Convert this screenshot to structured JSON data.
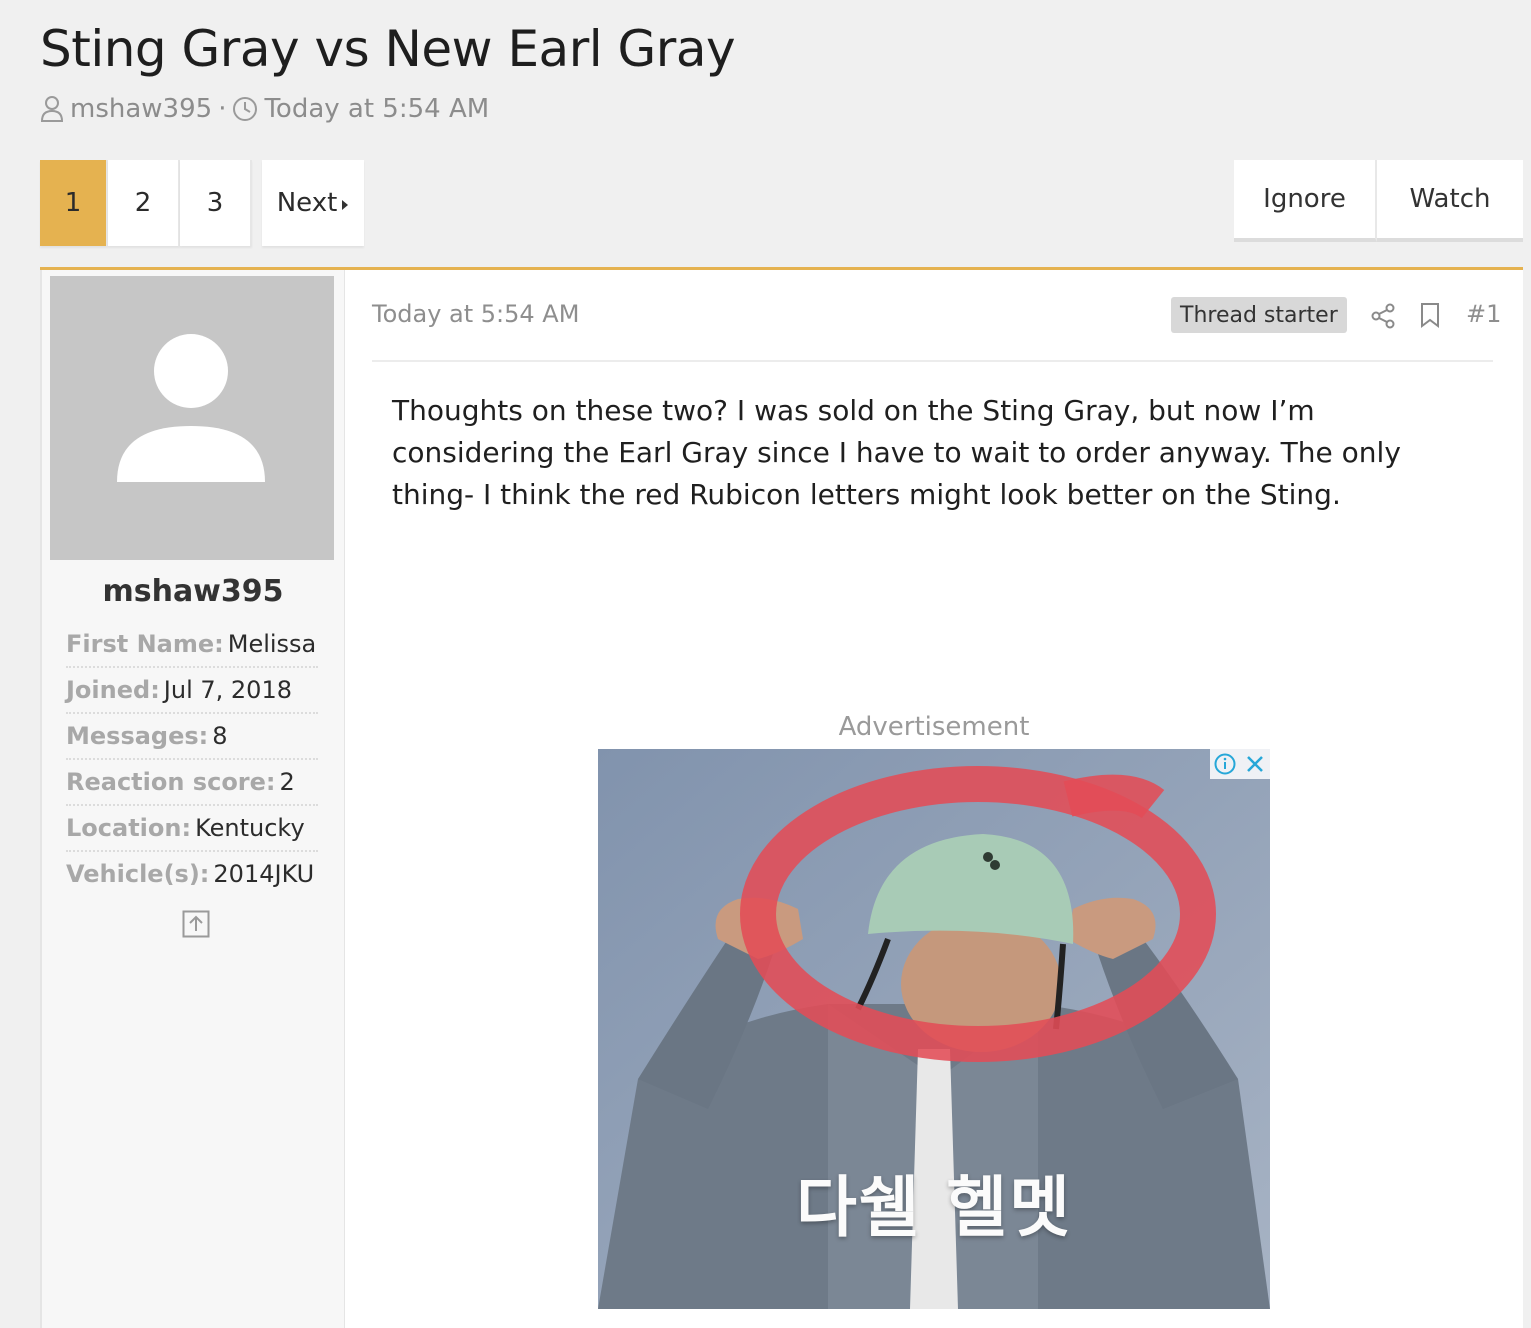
{
  "thread": {
    "title": "Sting Gray vs New Earl Gray",
    "author": "mshaw395",
    "separator": "·",
    "date": "Today at 5:54 AM"
  },
  "pagination": {
    "pages": [
      "1",
      "2",
      "3"
    ],
    "current": "1",
    "next_label": "Next"
  },
  "actions": {
    "ignore_label": "Ignore",
    "watch_label": "Watch"
  },
  "post": {
    "user": {
      "username": "mshaw395",
      "extras": [
        {
          "label": "First Name:",
          "value": "Melissa"
        },
        {
          "label": "Joined:",
          "value": "Jul 7, 2018"
        },
        {
          "label": "Messages:",
          "value": "8"
        },
        {
          "label": "Reaction score:",
          "value": "2"
        },
        {
          "label": "Location:",
          "value": "Kentucky"
        },
        {
          "label": "Vehicle(s):",
          "value": "2014JKU"
        }
      ]
    },
    "date": "Today at 5:54 AM",
    "badge": "Thread starter",
    "number": "#1",
    "body": "Thoughts on these two? I was sold on the Sting Gray, but now I’m considering the Earl Gray since I have to wait to order anyway. The only thing- I think the red Rubicon letters might look better on the Sting."
  },
  "ad": {
    "label": "Advertisement",
    "text": "다쉘 헬멧"
  },
  "colors": {
    "accent": "#e5b250",
    "page_bg": "#f0f0f0",
    "muted": "#8c8c8c"
  },
  "icons": [
    "user-icon",
    "clock-icon",
    "caret-right-icon",
    "avatar-icon",
    "collapse-icon",
    "share-icon",
    "bookmark-icon",
    "info-icon",
    "close-icon"
  ]
}
